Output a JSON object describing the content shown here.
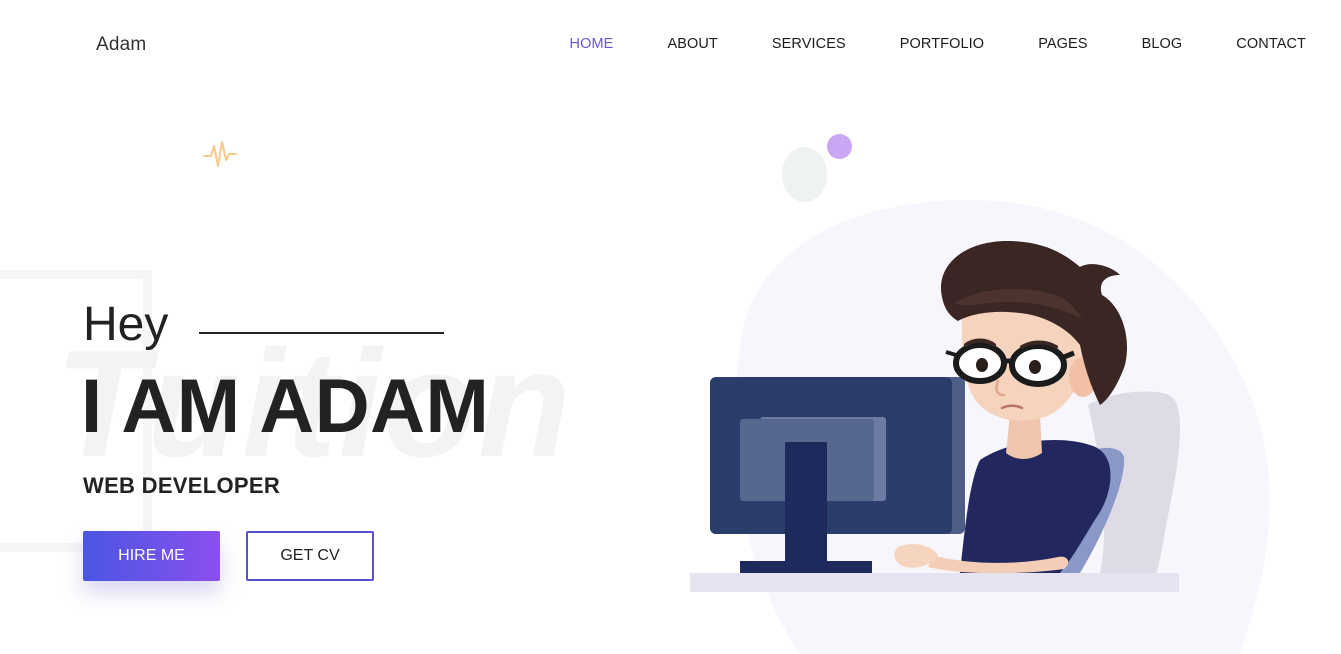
{
  "header": {
    "logo": "Adam",
    "nav": [
      {
        "label": "HOME",
        "active": true
      },
      {
        "label": "ABOUT",
        "active": false
      },
      {
        "label": "SERVICES",
        "active": false
      },
      {
        "label": "PORTFOLIO",
        "active": false
      },
      {
        "label": "PAGES",
        "active": false
      },
      {
        "label": "BLOG",
        "active": false
      },
      {
        "label": "CONTACT",
        "active": false
      }
    ]
  },
  "hero": {
    "greeting": "Hey",
    "name": "I AM ADAM",
    "role": "WEB DEVELOPER",
    "watermark": "Tuition",
    "buttons": {
      "hire": "HIRE ME",
      "cv": "GET CV"
    }
  },
  "colors": {
    "accent": "#6a5acd",
    "gradient_start": "#4a56e2",
    "gradient_end": "#8a4ff0",
    "text": "#222222"
  },
  "icons": [
    "pulse-icon",
    "developer-illustration"
  ]
}
